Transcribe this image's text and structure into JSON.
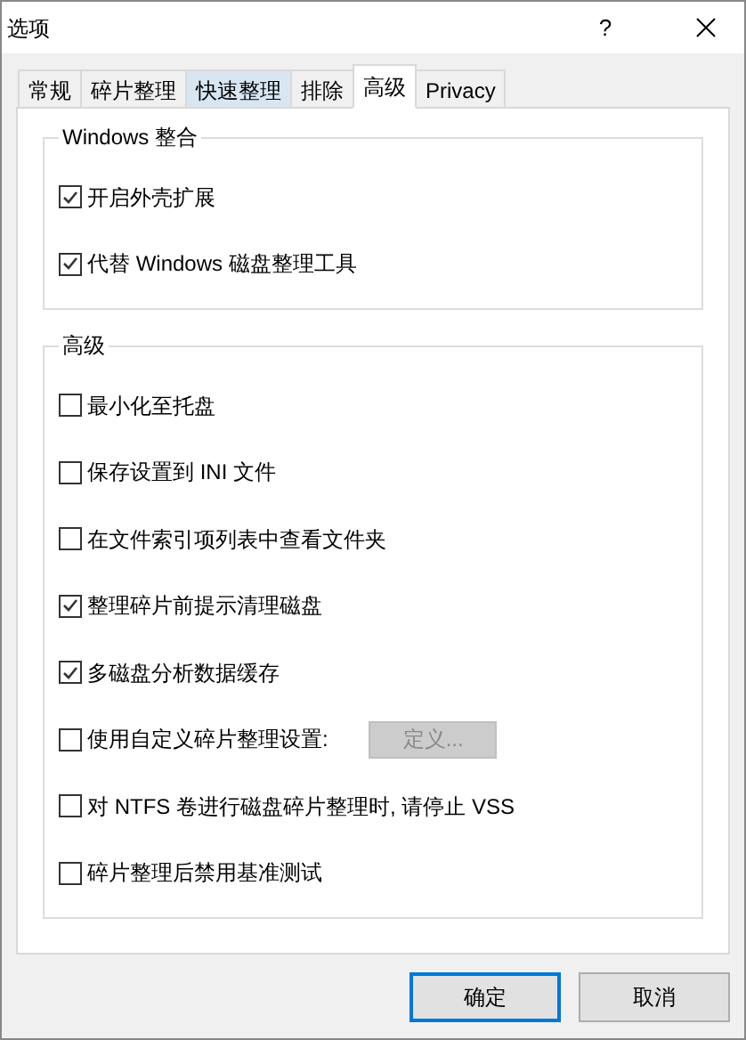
{
  "window": {
    "title": "选项",
    "help": "?"
  },
  "tabs": [
    {
      "label": "常规",
      "selected": false,
      "hovered": false
    },
    {
      "label": "碎片整理",
      "selected": false,
      "hovered": false
    },
    {
      "label": "快速整理",
      "selected": false,
      "hovered": true
    },
    {
      "label": "排除",
      "selected": false,
      "hovered": false
    },
    {
      "label": "高级",
      "selected": true,
      "hovered": false
    },
    {
      "label": "Privacy",
      "selected": false,
      "hovered": false
    }
  ],
  "groups": [
    {
      "title": "Windows 整合",
      "items": [
        {
          "label": "开启外壳扩展",
          "checked": true
        },
        {
          "label": "代替 Windows 磁盘整理工具",
          "checked": true
        }
      ]
    },
    {
      "title": "高级",
      "items": [
        {
          "label": "最小化至托盘",
          "checked": false
        },
        {
          "label": "保存设置到 INI 文件",
          "checked": false
        },
        {
          "label": "在文件索引项列表中查看文件夹",
          "checked": false
        },
        {
          "label": "整理碎片前提示清理磁盘",
          "checked": true
        },
        {
          "label": "多磁盘分析数据缓存",
          "checked": true
        },
        {
          "label": "使用自定义碎片整理设置:",
          "checked": false,
          "button": {
            "label": "定义...",
            "disabled": true
          }
        },
        {
          "label": "对 NTFS 卷进行磁盘碎片整理时, 请停止 VSS",
          "checked": false
        },
        {
          "label": "碎片整理后禁用基准测试",
          "checked": false
        }
      ]
    }
  ],
  "buttons": [
    {
      "label": "确定",
      "default": true
    },
    {
      "label": "取消",
      "default": false
    }
  ]
}
